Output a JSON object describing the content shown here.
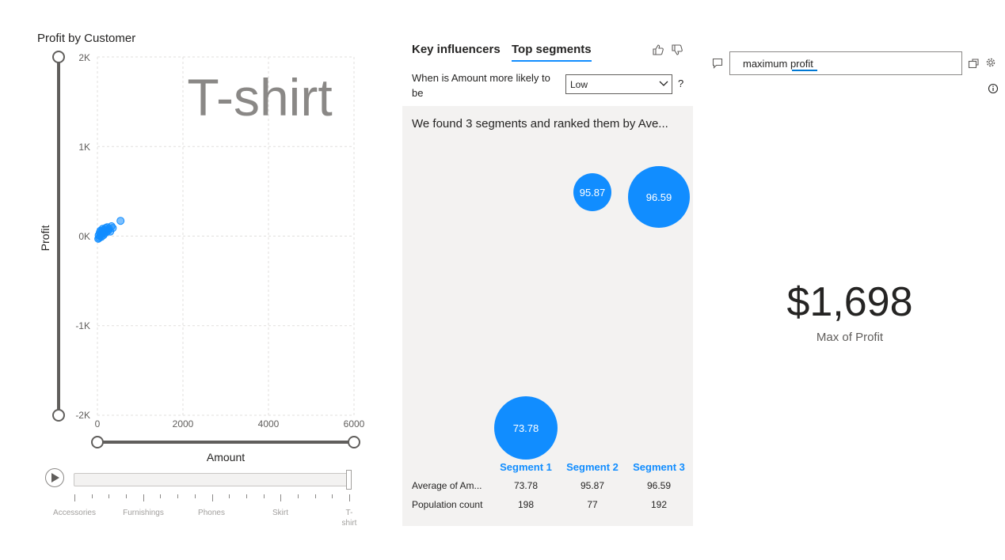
{
  "scatter": {
    "title": "Profit by Customer",
    "watermark": "T-shirt",
    "y_ticks": [
      "2K",
      "1K",
      "0K",
      "-1K",
      "-2K"
    ],
    "x_ticks": [
      "0",
      "2000",
      "4000",
      "6000"
    ]
  },
  "chart_data": {
    "type": "scatter",
    "title": "Profit by Customer",
    "xlabel": "Amount",
    "ylabel": "Profit",
    "xlim": [
      0,
      6000
    ],
    "ylim": [
      -2000,
      2000
    ],
    "grid": true,
    "series": [
      {
        "points": [
          [
            20,
            -30
          ],
          [
            30,
            10
          ],
          [
            40,
            -20
          ],
          [
            55,
            40
          ],
          [
            60,
            0
          ],
          [
            70,
            60
          ],
          [
            80,
            20
          ],
          [
            90,
            -10
          ],
          [
            100,
            50
          ],
          [
            110,
            30
          ],
          [
            120,
            80
          ],
          [
            130,
            40
          ],
          [
            140,
            10
          ],
          [
            150,
            70
          ],
          [
            160,
            30
          ],
          [
            175,
            60
          ],
          [
            190,
            90
          ],
          [
            200,
            40
          ],
          [
            215,
            70
          ],
          [
            230,
            100
          ],
          [
            250,
            60
          ],
          [
            270,
            80
          ],
          [
            300,
            50
          ],
          [
            330,
            110
          ],
          [
            360,
            90
          ],
          [
            540,
            170
          ]
        ]
      }
    ]
  },
  "play_axis": {
    "labels": [
      "Accessories",
      "Furnishings",
      "Phones",
      "Skirt",
      "T-\nshirt"
    ],
    "current": "T-shirt"
  },
  "influencers": {
    "tabs": [
      "Key influencers",
      "Top segments"
    ],
    "active_tab": "Top segments",
    "question": "When is Amount more likely to be",
    "dropdown_value": "Low",
    "help": "?",
    "headline": "We found 3 segments and ranked them by Ave...",
    "segments": [
      {
        "name": "Segment 1",
        "value": "73.78",
        "count": "198"
      },
      {
        "name": "Segment 2",
        "value": "95.87",
        "count": "77"
      },
      {
        "name": "Segment 3",
        "value": "96.59",
        "count": "192"
      }
    ],
    "row_labels": [
      "Average of Am...",
      "Population count"
    ]
  },
  "qa": {
    "query": "maximum profit",
    "kpi_value": "$1,698",
    "kpi_label": "Max of Profit"
  },
  "colors": {
    "accent": "#118dff",
    "panel_bg": "#f3f2f1",
    "text": "#252423"
  }
}
